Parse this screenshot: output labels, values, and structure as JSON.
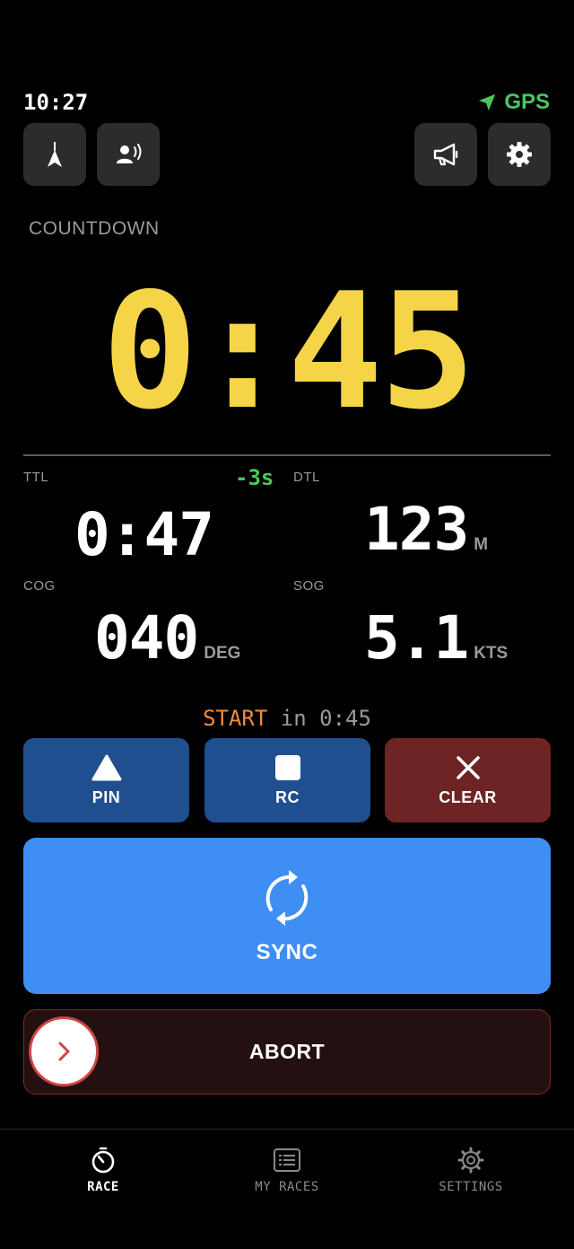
{
  "status": {
    "time": "10:27",
    "gps_label": "GPS"
  },
  "toolbar": {
    "icons": [
      "compass-icon",
      "voice-icon",
      "megaphone-icon",
      "gear-icon"
    ]
  },
  "countdown": {
    "label": "COUNTDOWN",
    "value": "0:45"
  },
  "metrics": {
    "ttl": {
      "label": "TTL",
      "value": "0:47",
      "delta": "-3s"
    },
    "dtl": {
      "label": "DTL",
      "value": "123",
      "unit": "M"
    },
    "cog": {
      "label": "COG",
      "value": "040",
      "unit": "DEG"
    },
    "sog": {
      "label": "SOG",
      "value": "5.1",
      "unit": "KTS"
    }
  },
  "start": {
    "word": "START",
    "rest": " in 0:45"
  },
  "buttons": {
    "pin": "PIN",
    "rc": "RC",
    "clear": "CLEAR",
    "sync": "SYNC",
    "abort": "ABORT"
  },
  "tabs": [
    {
      "label": "RACE",
      "icon": "stopwatch-icon",
      "active": true
    },
    {
      "label": "MY RACES",
      "icon": "list-icon",
      "active": false
    },
    {
      "label": "SETTINGS",
      "icon": "gear-icon",
      "active": false
    }
  ],
  "colors": {
    "countdown": "#f5d547",
    "positive": "#4cc55e",
    "start_word": "#f08a3e",
    "mark_blue": "#1f4f8f",
    "clear_red": "#6e2424",
    "sync_blue": "#3f8ef3",
    "abort_border": "#7a2a2a"
  }
}
